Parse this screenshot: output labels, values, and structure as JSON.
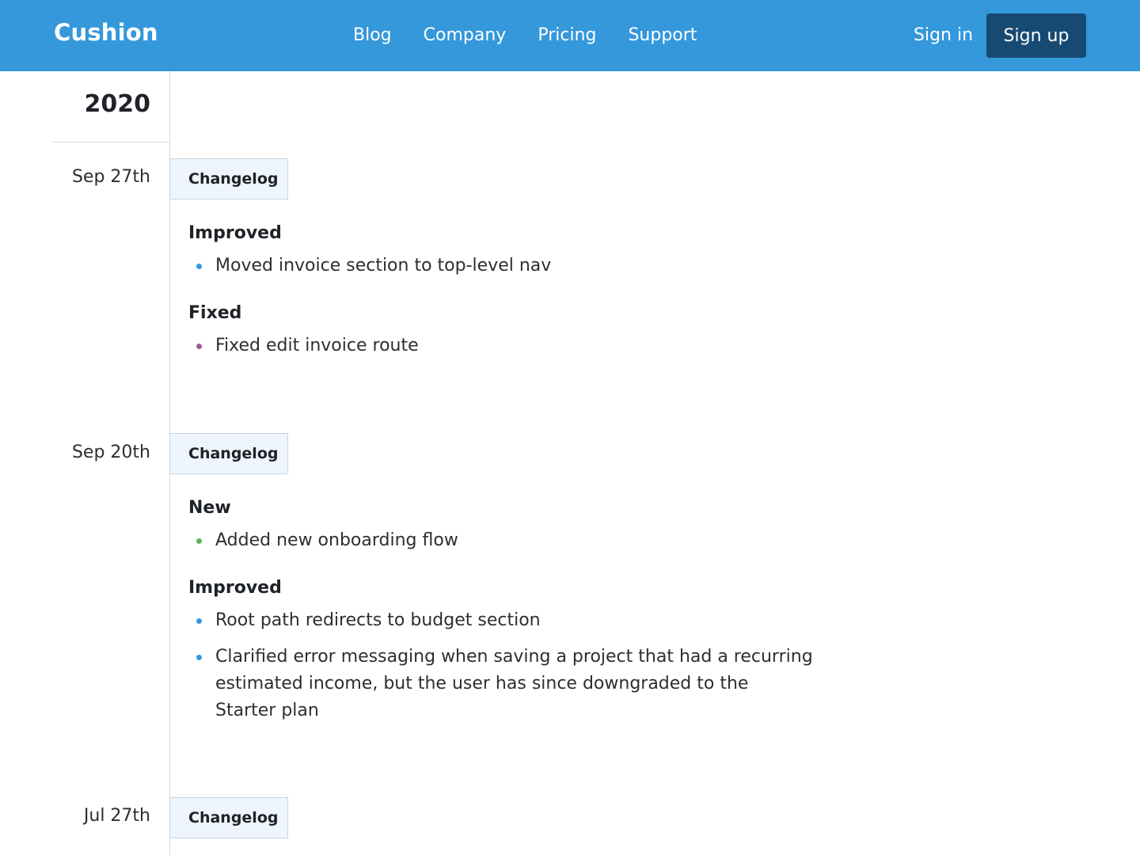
{
  "header": {
    "logo": "Cushion",
    "nav": [
      "Blog",
      "Company",
      "Pricing",
      "Support"
    ],
    "sign_in": "Sign in",
    "sign_up": "Sign up"
  },
  "timeline": {
    "year": "2020",
    "entries": [
      {
        "date": "Sep 27th",
        "tag": "Changelog",
        "sections": [
          {
            "title": "Improved",
            "bullet_color": "#3498db",
            "items": [
              "Moved invoice section to top-level nav"
            ]
          },
          {
            "title": "Fixed",
            "bullet_color": "#a05a9a",
            "items": [
              "Fixed edit invoice route"
            ]
          }
        ]
      },
      {
        "date": "Sep 20th",
        "tag": "Changelog",
        "sections": [
          {
            "title": "New",
            "bullet_color": "#5cb85c",
            "items": [
              "Added new onboarding flow"
            ]
          },
          {
            "title": "Improved",
            "bullet_color": "#3498db",
            "items": [
              "Root path redirects to budget section",
              "Clarified error messaging when saving a project that had a recurring estimated income, but the user has since downgraded to the Starter plan"
            ]
          }
        ]
      },
      {
        "date": "Jul 27th",
        "tag": "Changelog",
        "sections": []
      }
    ]
  }
}
